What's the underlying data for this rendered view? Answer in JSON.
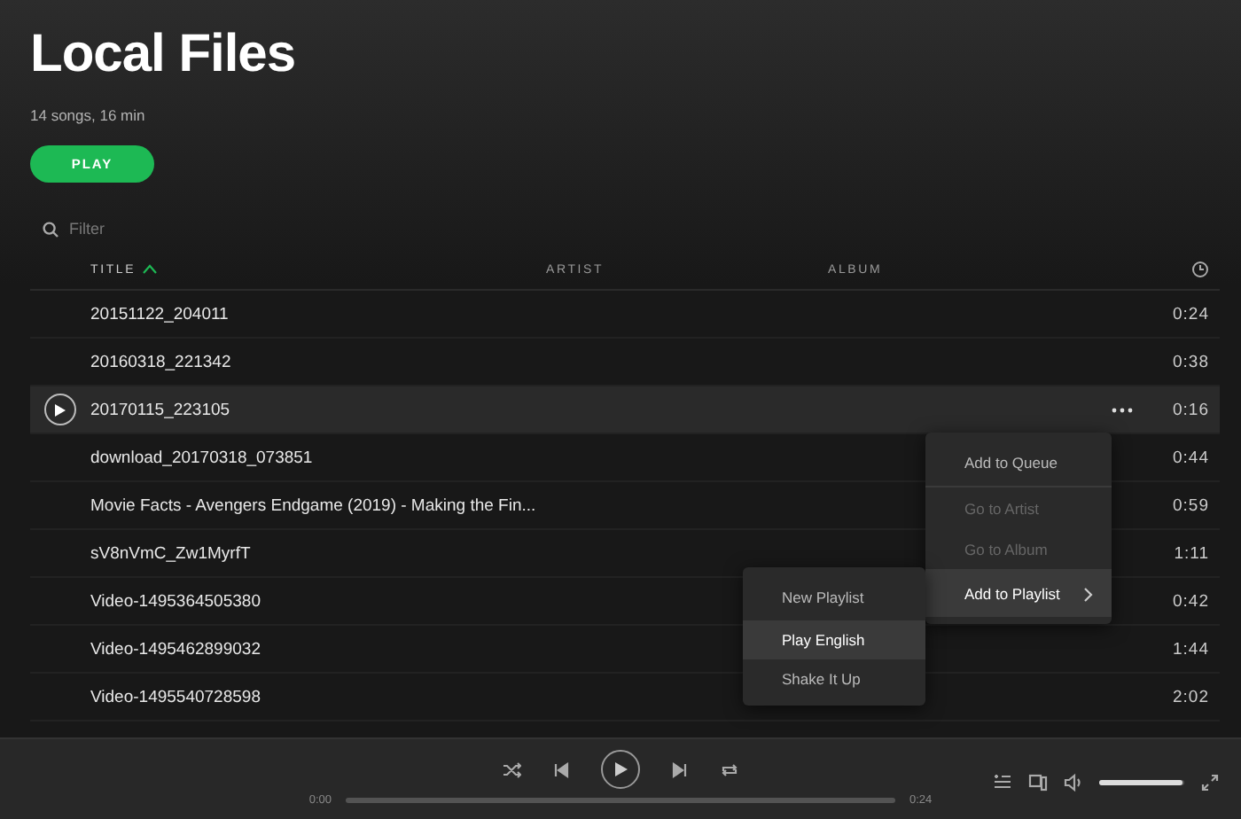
{
  "header": {
    "title": "Local Files",
    "subtitle": "14 songs, 16 min",
    "play_button": "PLAY"
  },
  "filter": {
    "placeholder": "Filter"
  },
  "table": {
    "columns": [
      {
        "label": "TITLE",
        "sorted": true
      },
      {
        "label": "ARTIST",
        "sorted": false
      },
      {
        "label": "ALBUM",
        "sorted": false
      }
    ],
    "rows": [
      {
        "title": "20151122_204011",
        "duration": "0:24",
        "selected": false
      },
      {
        "title": "20160318_221342",
        "duration": "0:38",
        "selected": false
      },
      {
        "title": "20170115_223105",
        "duration": "0:16",
        "selected": true
      },
      {
        "title": "download_20170318_073851",
        "duration": "0:44",
        "selected": false
      },
      {
        "title": "Movie Facts - Avengers Endgame (2019) - Making the Fin...",
        "duration": "0:59",
        "selected": false
      },
      {
        "title": "sV8nVmC_Zw1MyrfT",
        "duration": "1:11",
        "selected": false
      },
      {
        "title": "Video-1495364505380",
        "duration": "0:42",
        "selected": false
      },
      {
        "title": "Video-1495462899032",
        "duration": "1:44",
        "selected": false
      },
      {
        "title": "Video-1495540728598",
        "duration": "2:02",
        "selected": false
      }
    ]
  },
  "context_menu": {
    "items": [
      {
        "label": "Add to Queue",
        "disabled": false,
        "selected": false,
        "submenu": false
      },
      {
        "label": "Go to Artist",
        "disabled": true,
        "selected": false,
        "submenu": false
      },
      {
        "label": "Go to Album",
        "disabled": true,
        "selected": false,
        "submenu": false
      },
      {
        "label": "Add to Playlist",
        "disabled": false,
        "selected": true,
        "submenu": true
      }
    ]
  },
  "submenu": {
    "items": [
      {
        "label": "New Playlist",
        "selected": false
      },
      {
        "label": "Play English",
        "selected": true
      },
      {
        "label": "Shake It Up",
        "selected": false
      }
    ]
  },
  "player": {
    "elapsed": "0:00",
    "total": "0:24",
    "volume": {
      "level": 0.97
    }
  }
}
